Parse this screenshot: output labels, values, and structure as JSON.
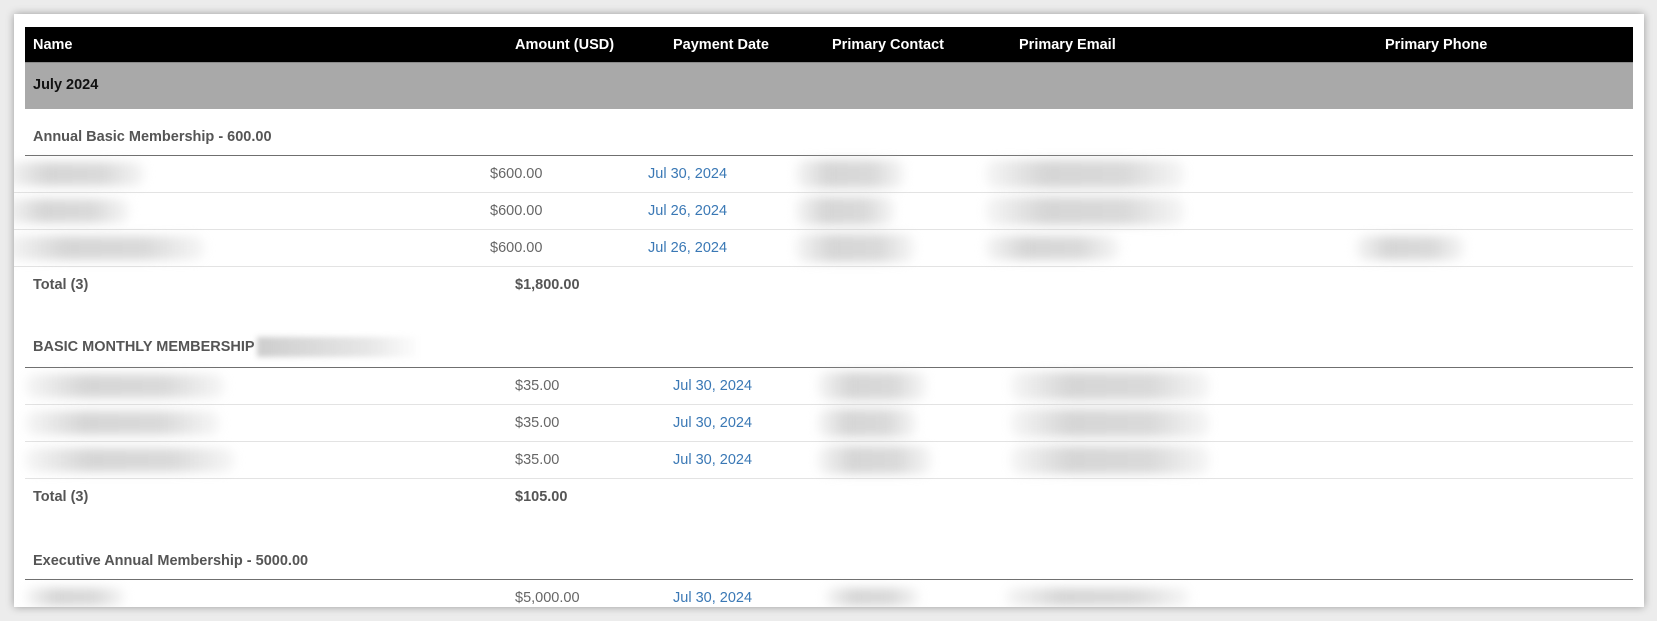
{
  "columns": {
    "name": "Name",
    "amount": "Amount (USD)",
    "payment_date": "Payment Date",
    "primary_contact": "Primary Contact",
    "primary_email": "Primary Email",
    "primary_phone": "Primary Phone"
  },
  "month": "July 2024",
  "groups": [
    {
      "title": "Annual Basic Membership - 600.00",
      "rows": [
        {
          "amount": "$600.00",
          "date": "Jul 30, 2024"
        },
        {
          "amount": "$600.00",
          "date": "Jul 26, 2024"
        },
        {
          "amount": "$600.00",
          "date": "Jul 26, 2024"
        }
      ],
      "total_label": "Total (3)",
      "total_value": "$1,800.00"
    },
    {
      "title": "BASIC MONTHLY MEMBERSHIP",
      "rows": [
        {
          "amount": "$35.00",
          "date": "Jul 30, 2024"
        },
        {
          "amount": "$35.00",
          "date": "Jul 30, 2024"
        },
        {
          "amount": "$35.00",
          "date": "Jul 30, 2024"
        }
      ],
      "total_label": "Total (3)",
      "total_value": "$105.00"
    },
    {
      "title": "Executive Annual Membership - 5000.00",
      "rows": [
        {
          "amount": "$5,000.00",
          "date": "Jul 30, 2024"
        }
      ]
    }
  ]
}
